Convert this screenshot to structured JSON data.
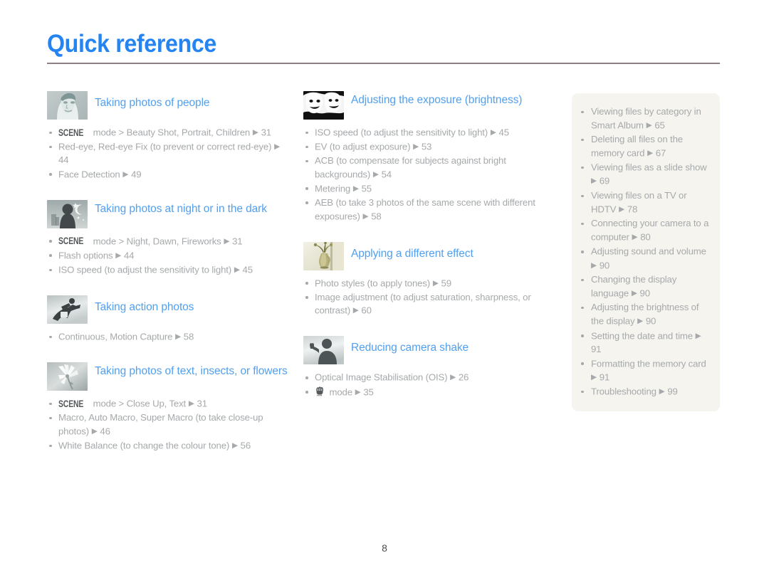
{
  "page": {
    "title": "Quick reference",
    "number": "8",
    "accent_color": "#2684f0",
    "section_title_color": "#51a0ef",
    "body_text_color": "#a6a9ab",
    "rule_color": "#8d8084",
    "panel_background": "#f6f4ef"
  },
  "columns": [
    {
      "sections": [
        {
          "icon": "woman-face-photo-icon",
          "title": "Taking photos of people",
          "items": [
            {
              "prefix": "SCENE",
              "text": " mode > Beauty Shot, Portrait, Children",
              "arrow": "▶",
              "page": "31"
            },
            {
              "text": "Red-eye, Red-eye Fix (to prevent or correct red-eye)",
              "arrow": "▶",
              "page": "44"
            },
            {
              "text": "Face Detection",
              "arrow": "▶",
              "page": "49"
            }
          ]
        },
        {
          "icon": "night-silhouette-moon-icon",
          "title": "Taking photos at night or in the dark",
          "items": [
            {
              "prefix": "SCENE",
              "text": " mode > Night, Dawn, Fireworks",
              "arrow": "▶",
              "page": "31"
            },
            {
              "text": "Flash options",
              "arrow": "▶",
              "page": "44"
            },
            {
              "text": "ISO speed (to adjust the sensitivity to light)",
              "arrow": "▶",
              "page": "45"
            }
          ]
        },
        {
          "icon": "snowboarder-action-icon",
          "title": "Taking action photos",
          "items": [
            {
              "text": "Continuous, Motion Capture",
              "arrow": "▶",
              "page": "58"
            }
          ]
        },
        {
          "icon": "white-flower-macro-icon",
          "title": "Taking photos of text, insects, or flowers",
          "items": [
            {
              "prefix": "SCENE",
              "text": " mode > Close Up, Text",
              "arrow": "▶",
              "page": "31"
            },
            {
              "text": "Macro, Auto Macro, Super Macro (to take close-up photos)",
              "arrow": "▶",
              "page": "46"
            },
            {
              "text": "White Balance (to change the colour tone)",
              "arrow": "▶",
              "page": "56"
            }
          ]
        }
      ]
    },
    {
      "sections": [
        {
          "icon": "two-faces-highcontrast-icon",
          "title": "Adjusting the exposure (brightness)",
          "items": [
            {
              "text": "ISO speed (to adjust the sensitivity to light)",
              "arrow": "▶",
              "page": "45"
            },
            {
              "text": "EV (to adjust exposure)",
              "arrow": "▶",
              "page": "53"
            },
            {
              "text": "ACB (to compensate for subjects against bright backgrounds)",
              "arrow": "▶",
              "page": "54"
            },
            {
              "text": "Metering",
              "arrow": "▶",
              "page": "55"
            },
            {
              "text": "AEB (to take 3 photos of the same scene with different exposures)",
              "arrow": "▶",
              "page": "58"
            }
          ]
        },
        {
          "icon": "sepia-vase-flowers-icon",
          "title": "Applying a different effect",
          "items": [
            {
              "text": "Photo styles (to apply tones)",
              "arrow": "▶",
              "page": "59"
            },
            {
              "text": "Image adjustment (to adjust saturation, sharpness, or contrast)",
              "arrow": "▶",
              "page": "60"
            }
          ]
        },
        {
          "icon": "person-raised-hand-icon",
          "title": "Reducing camera shake",
          "items": [
            {
              "text": "Optical Image Stabilisation (OIS)",
              "arrow": "▶",
              "page": "26"
            },
            {
              "glyph": "anti-shake-hand-icon",
              "text": " mode",
              "arrow": "▶",
              "page": "35"
            }
          ]
        }
      ]
    }
  ],
  "side_panel": {
    "items": [
      {
        "text": "Viewing files by category in Smart Album",
        "arrow": "▶",
        "page": "65"
      },
      {
        "text": "Deleting all files on the memory card",
        "arrow": "▶",
        "page": "67"
      },
      {
        "text": "Viewing files as a slide show",
        "arrow": "▶",
        "page": "69"
      },
      {
        "text": "Viewing files on a TV or HDTV",
        "arrow": "▶",
        "page": "78"
      },
      {
        "text": "Connecting your camera to a computer",
        "arrow": "▶",
        "page": "80"
      },
      {
        "text": "Adjusting sound and volume",
        "arrow": "▶",
        "page": "90"
      },
      {
        "text": "Changing the display language",
        "arrow": "▶",
        "page": "90"
      },
      {
        "text": "Adjusting the brightness of the display",
        "arrow": "▶",
        "page": "90"
      },
      {
        "text": "Setting the date and time",
        "arrow": "▶",
        "page": "91"
      },
      {
        "text": "Formatting the memory card",
        "arrow": "▶",
        "page": "91"
      },
      {
        "text": "Troubleshooting",
        "arrow": "▶",
        "page": "99"
      }
    ]
  }
}
